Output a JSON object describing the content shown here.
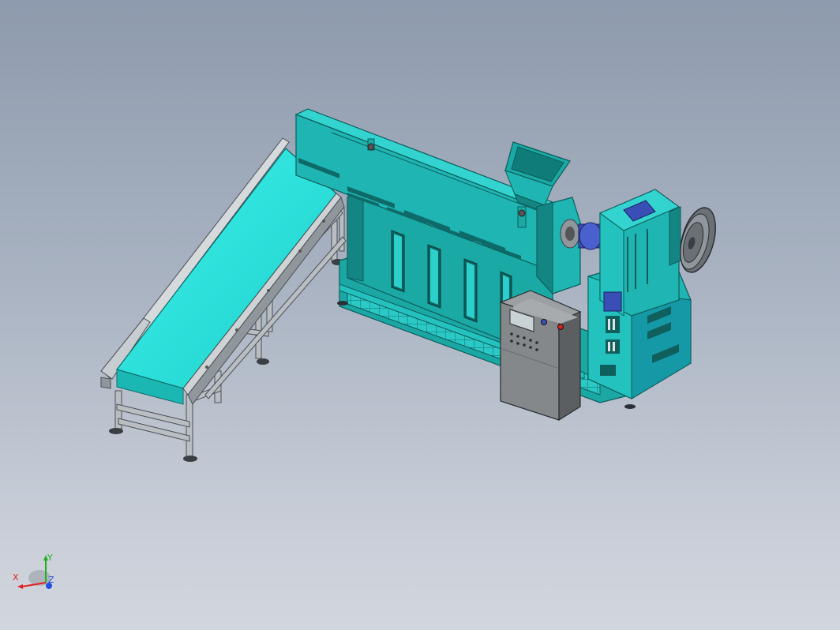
{
  "viewport": {
    "description_type": "3d-cad-model-viewport",
    "colors": {
      "body": "#1fb5b2",
      "body_dark": "#138683",
      "body_light": "#33d3cf",
      "belt": "#2ee8e3",
      "frame": "#8f969c",
      "frame_light": "#c4c9cd",
      "cabinet": "#6c6f72",
      "cabinet_light": "#9da0a3",
      "panel_blue": "#3a4fb5",
      "edge": "#1e2a2a"
    }
  },
  "triad": {
    "x_label": "X",
    "y_label": "Y",
    "z_label": "Z",
    "x_color": "#e02020",
    "y_color": "#20b020",
    "z_color": "#2050e0"
  }
}
